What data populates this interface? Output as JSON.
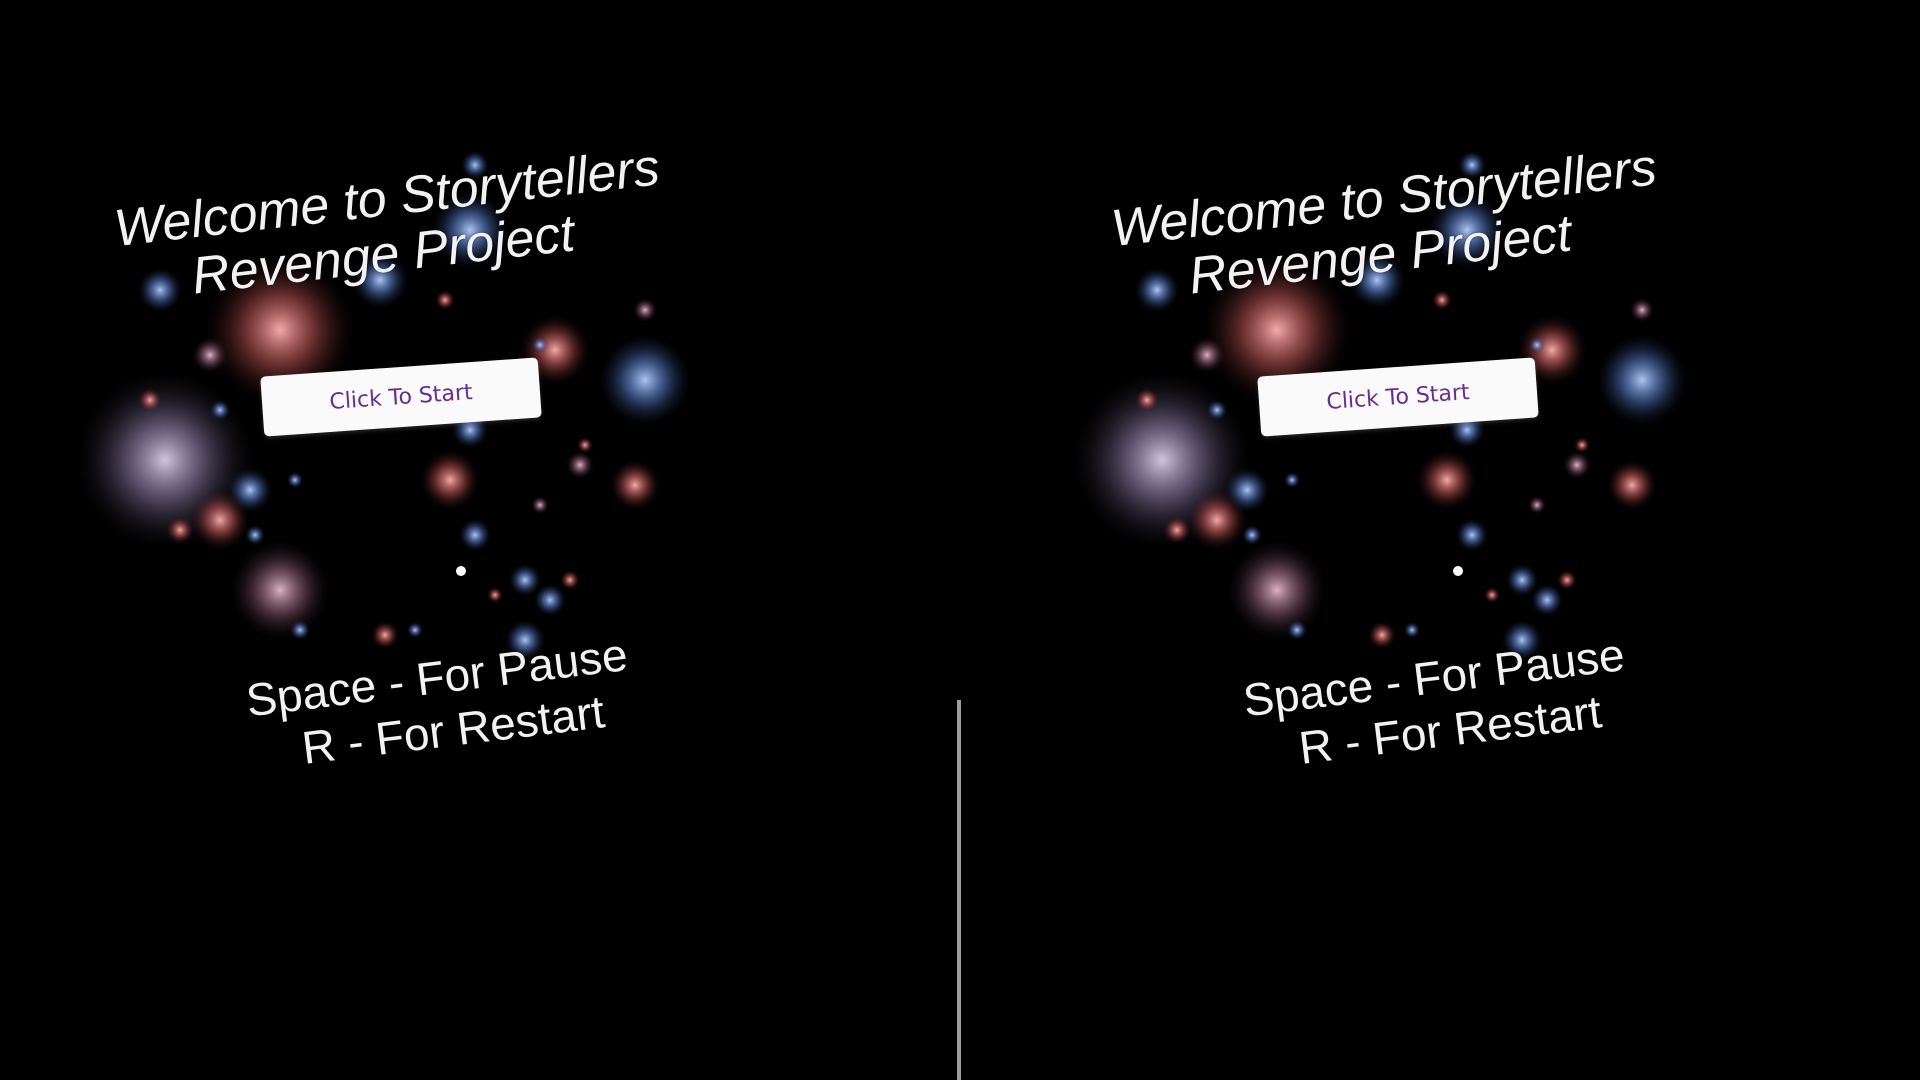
{
  "toolbar": {
    "close_icon": "close-icon",
    "settings_icon": "gear-icon"
  },
  "scene": {
    "title_line1": "Welcome to Storytellers",
    "title_line2": "Revenge Project",
    "start_button_label": "Click To Start",
    "controls_line1": "Space - For Pause",
    "controls_line2": "R - For Restart"
  },
  "colors": {
    "background": "#000000",
    "button_text": "#6a2c91",
    "button_bg": "#fafafa",
    "divider": "#9e9e9e"
  }
}
